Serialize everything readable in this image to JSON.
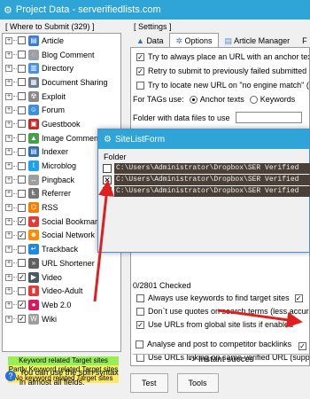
{
  "window": {
    "title": "Project Data - serverifiedlists.com"
  },
  "where_to_submit": {
    "caption": "[ Where to Submit  (329) ]",
    "items": [
      {
        "label": "Article",
        "checked": false,
        "icon": "article-icon",
        "color": "#3a7bd5",
        "glyph": "▤"
      },
      {
        "label": "Blog Comment",
        "checked": false,
        "icon": "blog-comment-icon",
        "color": "#9aa0a6",
        "glyph": "◌"
      },
      {
        "label": "Directory",
        "checked": false,
        "icon": "directory-icon",
        "color": "#4a90e2",
        "glyph": "▥"
      },
      {
        "label": "Document Sharing",
        "checked": false,
        "icon": "document-sharing-icon",
        "color": "#6b7b8c",
        "glyph": "▦"
      },
      {
        "label": "Exploit",
        "checked": false,
        "icon": "exploit-icon",
        "color": "#8a8a8a",
        "glyph": "☢"
      },
      {
        "label": "Forum",
        "checked": false,
        "icon": "forum-icon",
        "color": "#3d8fd8",
        "glyph": "☺"
      },
      {
        "label": "Guestbook",
        "checked": false,
        "icon": "guestbook-icon",
        "color": "#c62828",
        "glyph": "▣"
      },
      {
        "label": "Image Comment",
        "checked": false,
        "icon": "image-comment-icon",
        "color": "#43a047",
        "glyph": "▲"
      },
      {
        "label": "Indexer",
        "checked": false,
        "icon": "indexer-icon",
        "color": "#2f6db5",
        "glyph": "▤"
      },
      {
        "label": "Microblog",
        "checked": false,
        "icon": "microblog-icon",
        "color": "#1da1f2",
        "glyph": "t"
      },
      {
        "label": "Pingback",
        "checked": false,
        "icon": "pingback-icon",
        "color": "#9e9e9e",
        "glyph": "↔"
      },
      {
        "label": "Referrer",
        "checked": false,
        "icon": "referrer-icon",
        "color": "#757575",
        "glyph": "Ⱡ"
      },
      {
        "label": "RSS",
        "checked": false,
        "icon": "rss-icon",
        "color": "#f57c00",
        "glyph": "⌬"
      },
      {
        "label": "Social Bookmark",
        "checked": true,
        "icon": "social-bookmark-icon",
        "color": "#e53935",
        "glyph": "♥"
      },
      {
        "label": "Social Network",
        "checked": true,
        "icon": "social-network-icon",
        "color": "#fb8c00",
        "glyph": "☻"
      },
      {
        "label": "Trackback",
        "checked": false,
        "icon": "trackback-icon",
        "color": "#1e88e5",
        "glyph": "↵"
      },
      {
        "label": "URL Shortener",
        "checked": false,
        "icon": "url-shortener-icon",
        "color": "#616161",
        "glyph": "»"
      },
      {
        "label": "Video",
        "checked": true,
        "icon": "video-icon",
        "color": "#455a64",
        "glyph": "▶"
      },
      {
        "label": "Video-Adult",
        "checked": false,
        "icon": "video-adult-icon",
        "color": "#e53935",
        "glyph": "▮"
      },
      {
        "label": "Web 2.0",
        "checked": true,
        "icon": "web20-icon",
        "color": "#d81b60",
        "glyph": "●"
      },
      {
        "label": "Wiki",
        "checked": true,
        "icon": "wiki-icon",
        "color": "#9e9e9e",
        "glyph": "W"
      }
    ],
    "legend": [
      "Keyword related Target sites",
      "Partly Keyword related Target sites",
      "No keyword related Target sites"
    ],
    "hint": "You can use the spin syntax in almost all fields."
  },
  "settings": {
    "caption": "[ Settings ]",
    "tabs": [
      "Data",
      "Options",
      "Article Manager",
      "F"
    ],
    "options": {
      "opt1": "Try to always place an URL with an anchor text",
      "opt2": "Retry to submit to previously failed submitted sites",
      "opt3": "Try to locate new URL on \"no engine match\" (useful)",
      "tags_label": "For TAGs use:",
      "radio1": "Anchor texts",
      "radio2": "Keywords",
      "folder_label": "Folder with data files to use",
      "checked_count": "0/2801 Checked",
      "opt4": "Always use keywords to find target sites",
      "opt5": "Don`t use quotes on search terms (less accurate)",
      "opt6": "Use URLs from global site lists if enabled",
      "opt7": "Use URLs linking on same verified URL (supported)",
      "opt8": "Analyse and post to competitor backlinks",
      "instant": "-> Instant succes"
    }
  },
  "buttons": {
    "test": "Test",
    "tools": "Tools"
  },
  "dialog": {
    "title": "SiteListForm",
    "folder_label": "Folder",
    "folders": [
      {
        "path": "C:\\Users\\Administrator\\Dropbox\\SER Verified",
        "checked": false
      },
      {
        "path": "C:\\Users\\Administrator\\Dropbox\\SER Verified",
        "checked": true
      },
      {
        "path": "C:\\Users\\Administrator\\Dropbox\\SER Verified",
        "checked": false
      }
    ]
  },
  "colors": {
    "titlebar": "#2ea5d6",
    "arrow": "#e02020",
    "path_bg": "#4a4038"
  }
}
